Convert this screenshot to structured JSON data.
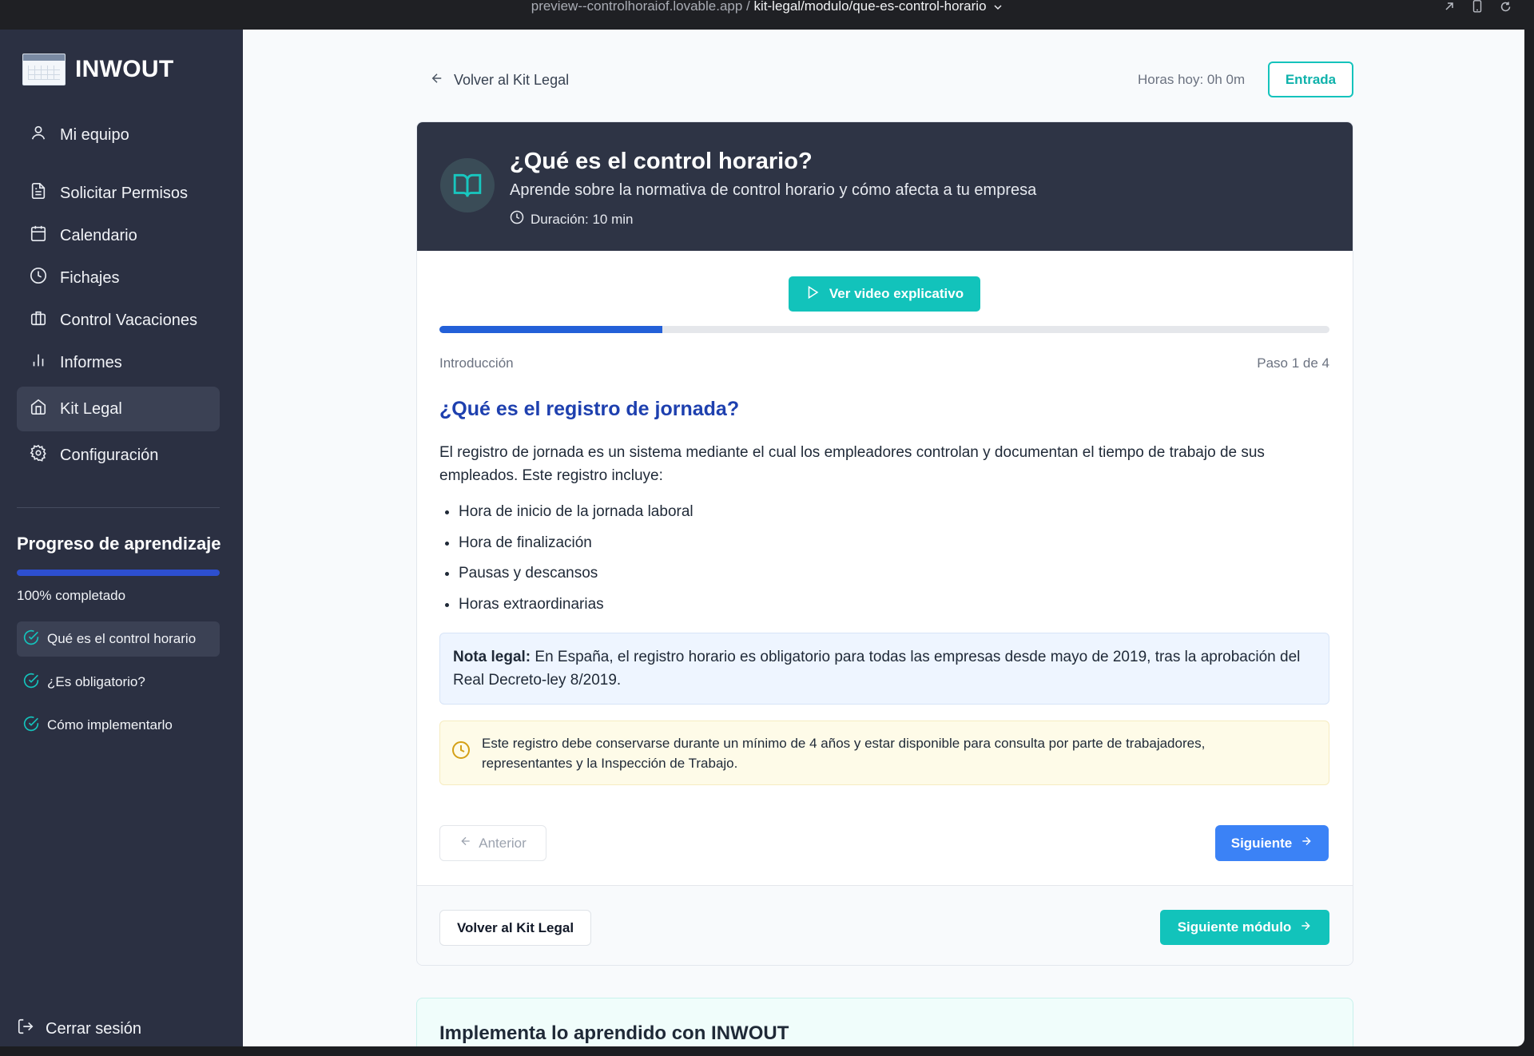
{
  "browser": {
    "url_host": "preview--controlhoraiof.lovable.app",
    "url_separator": " / ",
    "url_path": "kit-legal/modulo/que-es-control-horario"
  },
  "sidebar": {
    "brand": "INWOUT",
    "items": [
      {
        "label": "Mi equipo",
        "icon": "user-icon"
      },
      {
        "label": "Solicitar Permisos",
        "icon": "file-text-icon"
      },
      {
        "label": "Calendario",
        "icon": "calendar-icon"
      },
      {
        "label": "Fichajes",
        "icon": "clock-icon"
      },
      {
        "label": "Control Vacaciones",
        "icon": "luggage-icon"
      },
      {
        "label": "Informes",
        "icon": "bar-chart-icon"
      },
      {
        "label": "Kit Legal",
        "icon": "home-icon",
        "active": true
      },
      {
        "label": "Configuración",
        "icon": "gear-icon"
      }
    ],
    "progress": {
      "title": "Progreso de aprendizaje",
      "percent": 100,
      "label": "100% completado",
      "modules": [
        {
          "label": "Qué es el control horario",
          "active": true
        },
        {
          "label": "¿Es obligatorio?"
        },
        {
          "label": "Cómo implementarlo"
        }
      ]
    },
    "logout": "Cerrar sesión"
  },
  "header": {
    "back_label": "Volver al Kit Legal",
    "hours_label": "Horas hoy: 0h 0m",
    "entrada_label": "Entrada"
  },
  "module": {
    "title": "¿Qué es el control horario?",
    "subtitle": "Aprende sobre la normativa de control horario y cómo afecta a tu empresa",
    "duration": "Duración: 10 min",
    "video_button": "Ver video explicativo",
    "step_progress": 0.25,
    "step_name": "Introducción",
    "step_counter": "Paso 1 de 4",
    "section_title": "¿Qué es el registro de jornada?",
    "paragraph": "El registro de jornada es un sistema mediante el cual los empleadores controlan y documentan el tiempo de trabajo de sus empleados. Este registro incluye:",
    "bullets": [
      "Hora de inicio de la jornada laboral",
      "Hora de finalización",
      "Pausas y descansos",
      "Horas extraordinarias"
    ],
    "note_label": "Nota legal:",
    "note_text": " En España, el registro horario es obligatorio para todas las empresas desde mayo de 2019, tras la aprobación del Real Decreto-ley 8/2019.",
    "warning_text": "Este registro debe conservarse durante un mínimo de 4 años y estar disponible para consulta por parte de trabajadores, representantes y la Inspección de Trabajo.",
    "prev_label": "Anterior",
    "next_label": "Siguiente",
    "footer_back_label": "Volver al Kit Legal",
    "next_module_label": "Siguiente módulo"
  },
  "promo": {
    "title": "Implementa lo aprendido con INWOUT"
  },
  "colors": {
    "sidebar_bg": "#2b3042",
    "teal_accent": "#12c3bb",
    "blue_accent": "#3b82f6",
    "heading_blue": "#1e40af"
  }
}
